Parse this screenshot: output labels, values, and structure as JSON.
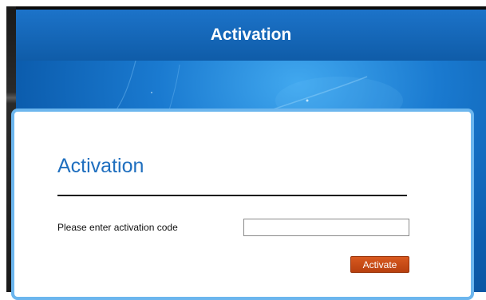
{
  "window": {
    "title": "Activation"
  },
  "form": {
    "heading": "Activation",
    "code_label": "Please enter activation code",
    "code_value": "",
    "code_placeholder": "",
    "activate_label": "Activate"
  },
  "colors": {
    "titlebar_blue": "#0f5ca8",
    "heading_blue": "#1f6fbf",
    "button_orange": "#c84a14",
    "card_border": "#6cb6ee"
  }
}
